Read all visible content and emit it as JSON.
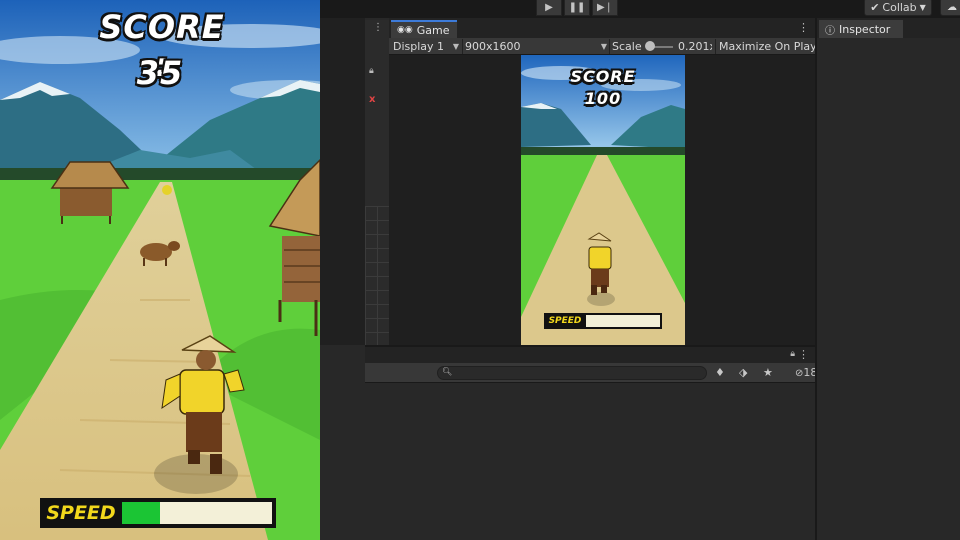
{
  "left_game": {
    "score_label": "SCORE :",
    "score_value": "35",
    "speed_label": "SPEED",
    "speed_fraction": 0.25
  },
  "toolbar": {
    "play_icon": "play-icon",
    "pause_icon": "pause-icon",
    "step_icon": "step-icon",
    "collab_label": "Collab",
    "collab_icon": "checkmark-icon",
    "cloud_icon": "cloud-icon"
  },
  "game_view": {
    "tab_label": "Game",
    "tab_icon": "gamepad-icon",
    "display_label": "Display 1",
    "resolution_label": "900x1600",
    "scale_label": "Scale",
    "scale_value": "0.201x",
    "maximize_label": "Maximize On Play"
  },
  "mini_game": {
    "score_label": "SCORE",
    "score_value": "100",
    "speed_label": "SPEED",
    "speed_fraction": 0.0
  },
  "hierarchy": {
    "search_placeholder": "",
    "hidden_count": "18"
  },
  "inspector": {
    "tab_label": "Inspector",
    "tab_icon": "info-icon"
  },
  "colors": {
    "accent_tab": "#3d7bd9",
    "speed_fill": "#1bc534",
    "speed_label_text": "#f2d81c"
  }
}
